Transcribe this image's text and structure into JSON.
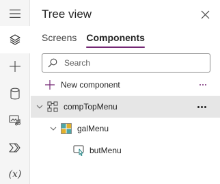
{
  "rail": {
    "items": [
      {
        "icon": "hamburger-menu-icon"
      },
      {
        "icon": "layers-icon",
        "active": true
      },
      {
        "icon": "plus-icon"
      },
      {
        "icon": "database-icon"
      },
      {
        "icon": "media-icon"
      },
      {
        "icon": "power-automate-icon"
      },
      {
        "icon": "variables-icon",
        "text": "(x)"
      }
    ]
  },
  "panel": {
    "title": "Tree view",
    "tabs": [
      {
        "label": "Screens",
        "selected": false
      },
      {
        "label": "Components",
        "selected": true
      }
    ],
    "search": {
      "placeholder": "Search"
    },
    "new_component_label": "New component",
    "tree": [
      {
        "label": "compTopMenu",
        "level": 0,
        "expanded": true,
        "selected": true
      },
      {
        "label": "galMenu",
        "level": 1,
        "expanded": true
      },
      {
        "label": "butMenu",
        "level": 2
      }
    ]
  },
  "colors": {
    "accent": "#742774",
    "selected_row": "#e6e6e6",
    "rail_bg": "#f5f5f5"
  }
}
